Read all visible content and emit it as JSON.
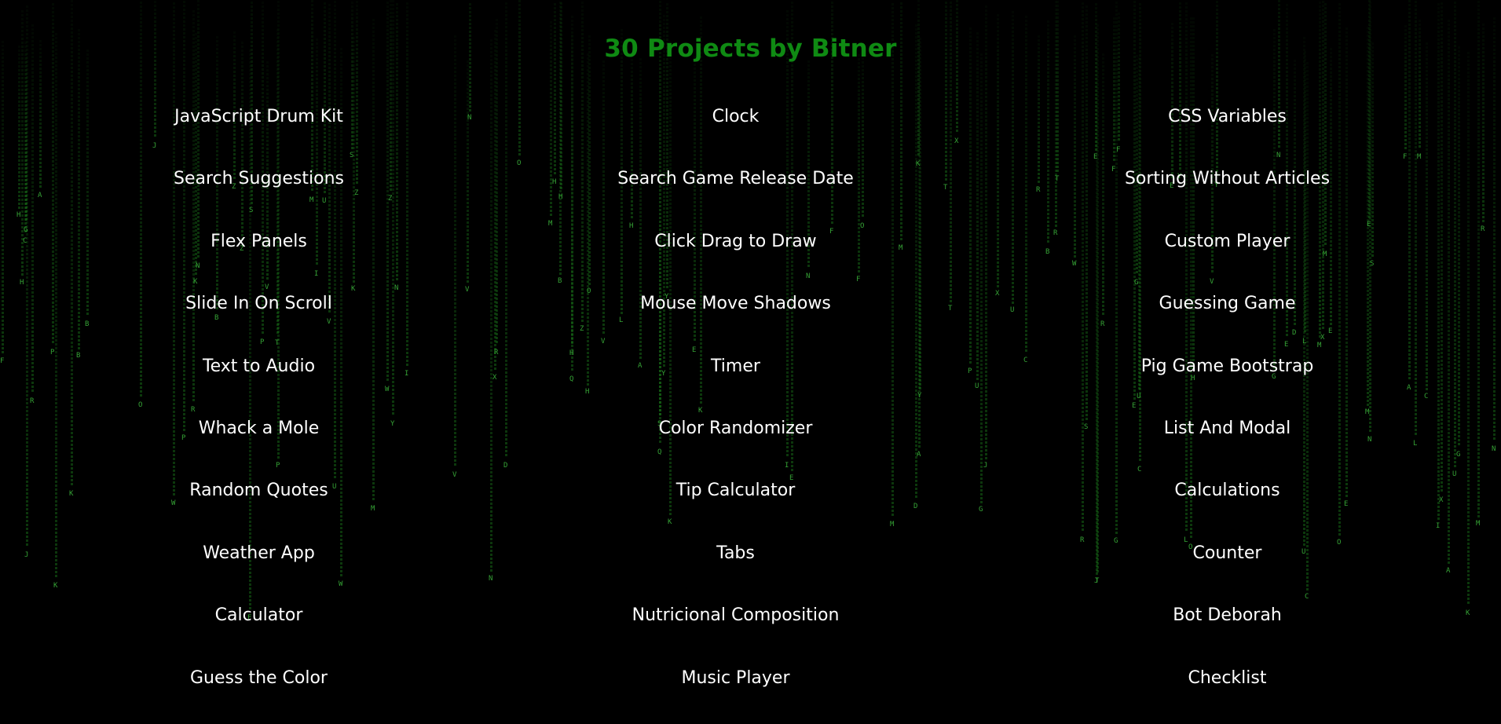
{
  "title": "30 Projects by Bitner",
  "colors": {
    "background": "#000000",
    "title": "#0f8a13",
    "link": "#ffffff",
    "rain": "#1f8f1f"
  },
  "columns": [
    {
      "projects": [
        "JavaScript Drum Kit",
        "Search Suggestions",
        "Flex Panels",
        "Slide In On Scroll",
        "Text to Audio",
        "Whack a Mole",
        "Random Quotes",
        "Weather App",
        "Calculator",
        "Guess the Color"
      ]
    },
    {
      "projects": [
        "Clock",
        "Search Game Release Date",
        "Click Drag to Draw",
        "Mouse Move Shadows",
        "Timer",
        "Color Randomizer",
        "Tip Calculator",
        "Tabs",
        "Nutricional Composition",
        "Music Player"
      ]
    },
    {
      "projects": [
        "CSS Variables",
        "Sorting Without Articles",
        "Custom Player",
        "Guessing Game",
        "Pig Game Bootstrap",
        "List And Modal",
        "Calculations",
        "Counter",
        "Bot Deborah",
        "Checklist"
      ]
    }
  ]
}
